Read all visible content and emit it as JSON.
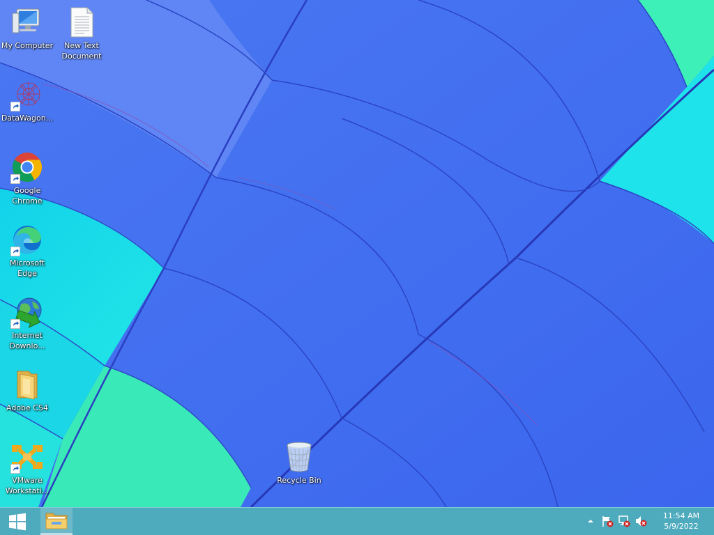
{
  "desktop": {
    "icons": [
      {
        "label": "My Computer",
        "icon": "computer-icon",
        "shortcut": false
      },
      {
        "label": "New Text\nDocument",
        "icon": "text-document-icon",
        "shortcut": false
      },
      {
        "label": "DataWagon...",
        "icon": "datawagon-icon",
        "shortcut": true
      },
      {
        "label": "Google\nChrome",
        "icon": "chrome-icon",
        "shortcut": true
      },
      {
        "label": "Microsoft\nEdge",
        "icon": "edge-icon",
        "shortcut": true
      },
      {
        "label": "Internet\nDownlo...",
        "icon": "internet-download-manager-icon",
        "shortcut": true
      },
      {
        "label": "Adobe CS4",
        "icon": "folder-icon",
        "shortcut": false
      },
      {
        "label": "VMware\nWorkstati...",
        "icon": "vmware-icon",
        "shortcut": true
      },
      {
        "label": "Recycle Bin",
        "icon": "recycle-bin-icon",
        "shortcut": false
      }
    ]
  },
  "taskbar": {
    "start_icon": "windows-logo-icon",
    "pinned": [
      {
        "icon": "file-explorer-icon"
      }
    ],
    "tray": {
      "icons": [
        "show-hidden-icons-chevron",
        "action-center-flag-icon",
        "network-disconnected-icon",
        "volume-muted-icon"
      ]
    },
    "clock": {
      "time": "11:54 AM",
      "date": "5/9/2022"
    }
  },
  "colors": {
    "taskbar": "#4eaabd",
    "wallpaper_blue": "#3f6ff0",
    "wallpaper_cyan": "#19dfe8",
    "wallpaper_mint": "#3af0b4"
  }
}
